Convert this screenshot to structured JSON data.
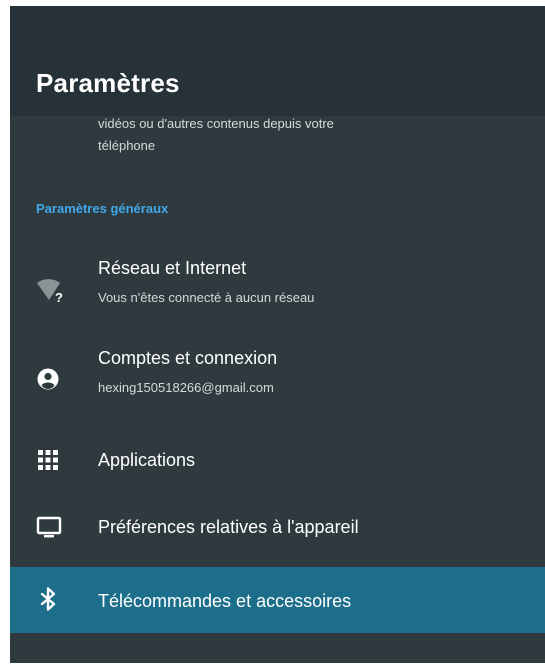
{
  "header": {
    "title": "Paramètres"
  },
  "partial_item": {
    "line1": "vidéos ou d'autres contenus depuis votre",
    "line2": "téléphone"
  },
  "section": {
    "title": "Paramètres généraux"
  },
  "items": [
    {
      "title": "Réseau et Internet",
      "subtitle": "Vous n'êtes connecté à aucun réseau",
      "icon": "wifi-question-icon"
    },
    {
      "title": "Comptes et connexion",
      "subtitle": "hexing150518266@gmail.com",
      "icon": "account-icon"
    },
    {
      "title": "Applications",
      "icon": "apps-grid-icon"
    },
    {
      "title": "Préférences relatives à l'appareil",
      "icon": "tv-icon"
    },
    {
      "title": "Télécommandes et accessoires",
      "icon": "bluetooth-icon",
      "selected": true
    }
  ],
  "colors": {
    "background": "#2f3a3f",
    "header_background": "#263238",
    "accent": "#43a8e9",
    "selected_row": "#1d6e8a",
    "text_primary": "#ffffff",
    "text_secondary": "#d6d9db"
  }
}
